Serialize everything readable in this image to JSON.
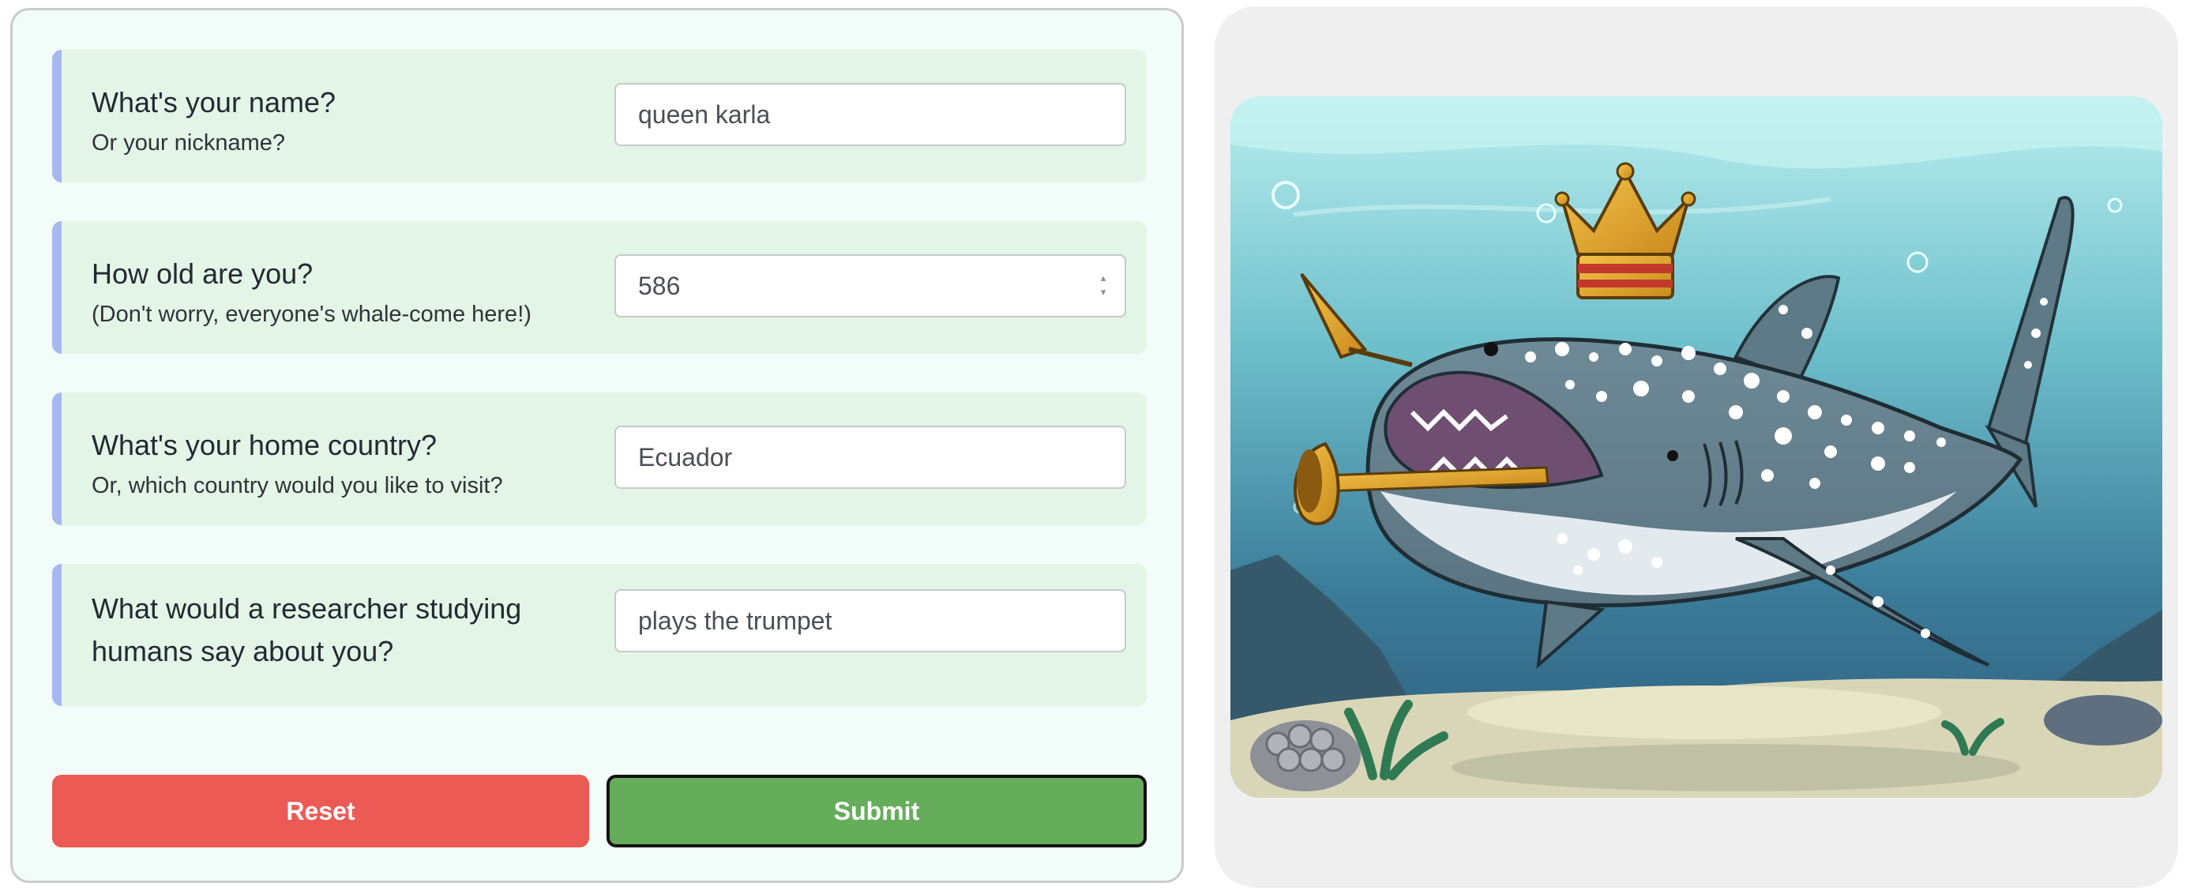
{
  "form": {
    "questions": [
      {
        "title": "What's your name?",
        "subtitle": "Or your nickname?",
        "value": "queen karla",
        "type": "text"
      },
      {
        "title": "How old are you?",
        "subtitle": "(Don't worry, everyone's whale-come here!)",
        "value": "586",
        "type": "number"
      },
      {
        "title": "What's your home country?",
        "subtitle": "Or, which country would you like to visit?",
        "value": "Ecuador",
        "type": "text"
      },
      {
        "title": "What would a researcher studying humans say about you?",
        "subtitle": "",
        "value": "plays the trumpet",
        "type": "text"
      }
    ],
    "reset_label": "Reset",
    "submit_label": "Submit"
  },
  "image": {
    "subject": "whale shark wearing a golden crown playing a trumpet underwater",
    "icons": [
      "chevron-up-icon",
      "chevron-down-icon"
    ]
  },
  "colors": {
    "card_background": "#e3f5e6",
    "card_accent": "#a6b8f0",
    "reset": "#ec5a56",
    "submit": "#66ad5b",
    "panel_background": "#f2fcf8"
  }
}
